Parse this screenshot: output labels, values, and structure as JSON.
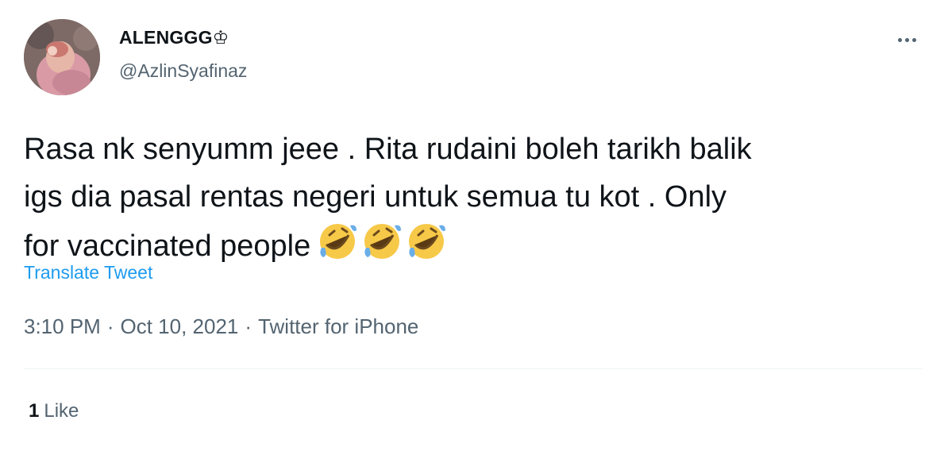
{
  "author": {
    "display_name": "ALENGGG♔",
    "handle": "@AzlinSyafinaz"
  },
  "tweet": {
    "text": "Rasa nk senyumm jeee . Rita rudaini boleh tarikh balik\nigs dia pasal rentas negeri untuk semua tu kot . Only\nfor vaccinated people",
    "emoji": [
      "rolling-on-floor-laughing-emoji",
      "rolling-on-floor-laughing-emoji",
      "rolling-on-floor-laughing-emoji"
    ],
    "translate_label": "Translate Tweet"
  },
  "meta": {
    "time": "3:10 PM",
    "date": "Oct 10, 2021",
    "source": "Twitter for iPhone",
    "separator": "·"
  },
  "stats": {
    "like_count": "1",
    "like_label": "Like"
  },
  "colors": {
    "text_primary": "#0f1419",
    "text_secondary": "#536471",
    "link": "#1d9bf0",
    "divider": "#eff3f4"
  },
  "icons": {
    "more": "more-horizontal-icon"
  }
}
